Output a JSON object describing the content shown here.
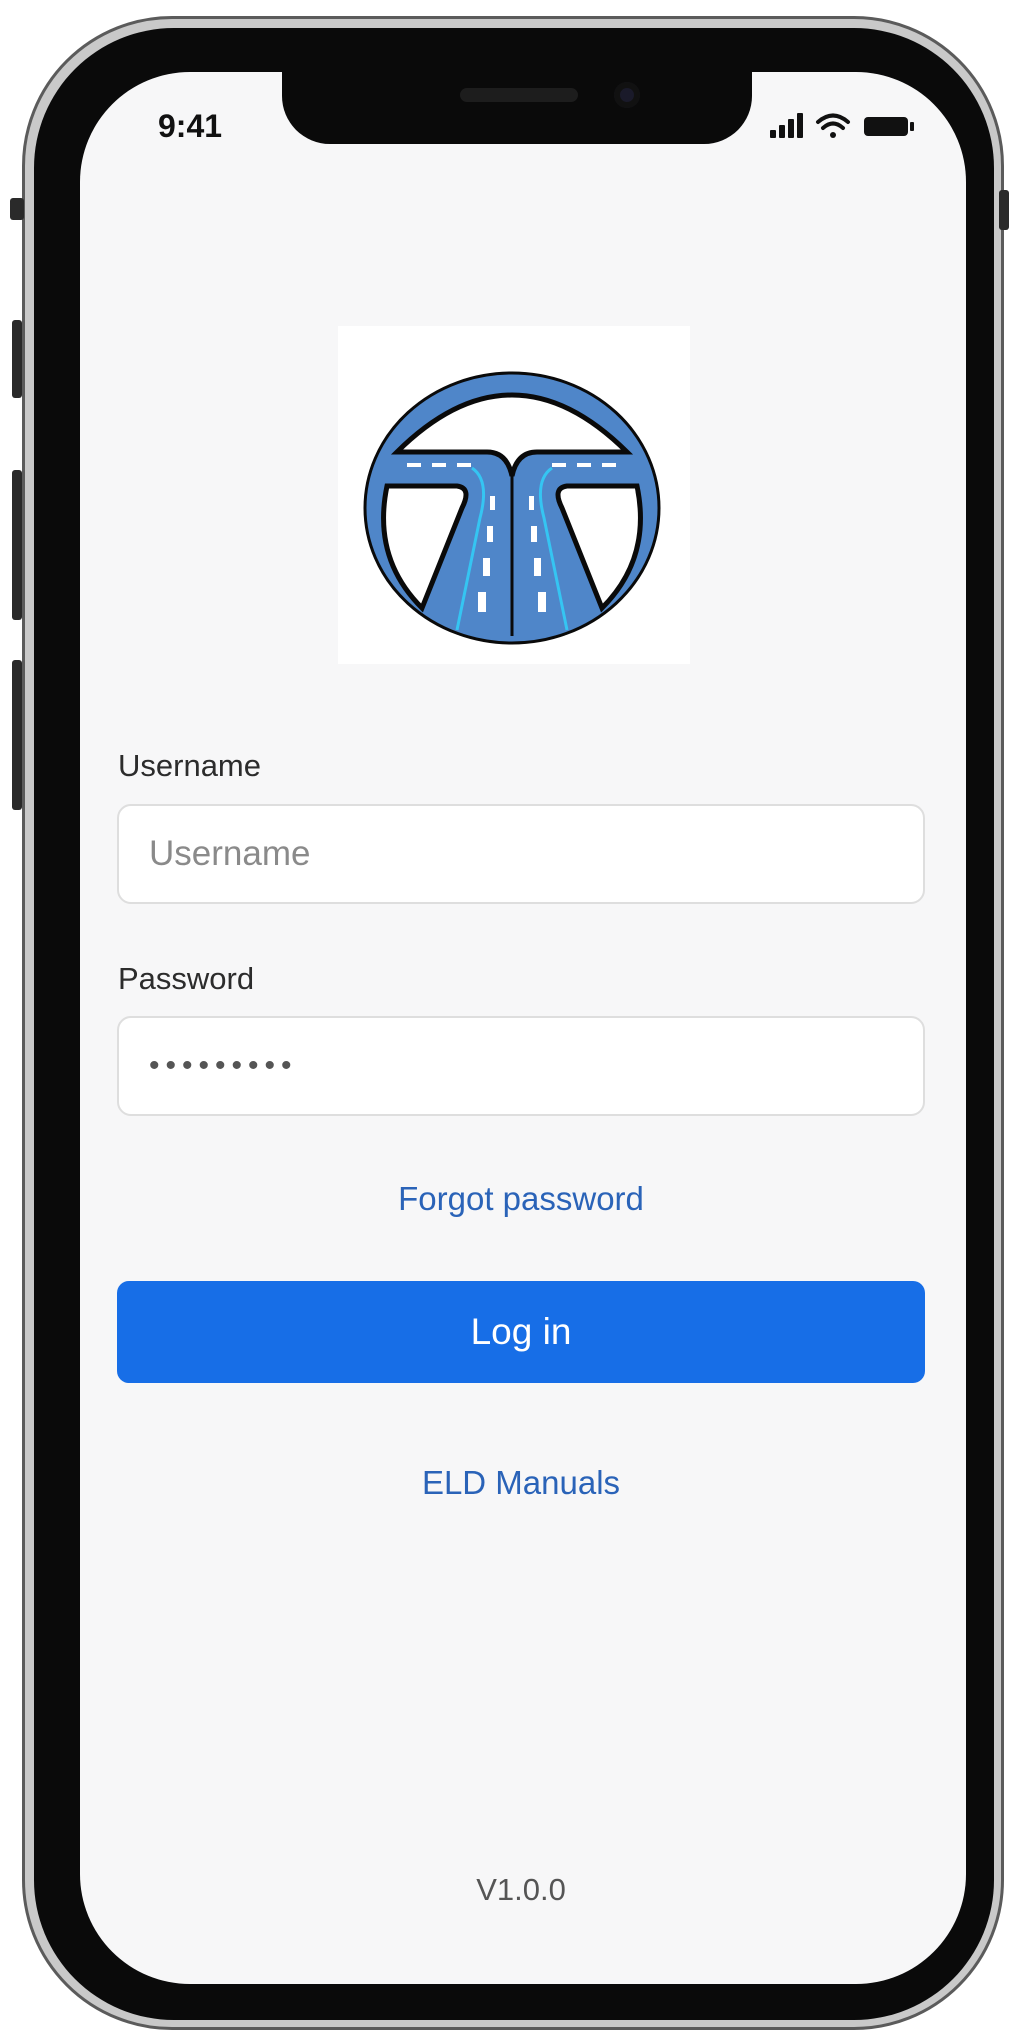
{
  "status_bar": {
    "time": "9:41",
    "icons": [
      "cellular-signal-icon",
      "wifi-icon",
      "battery-icon"
    ]
  },
  "logo": {
    "name": "road-logo",
    "colors": {
      "ring": "#4f86c9",
      "road": "#4f86c9",
      "outline": "#0a0a0a",
      "lane_marks": "#ffffff",
      "edge_glow": "#35c5f2"
    }
  },
  "login_form": {
    "username": {
      "label": "Username",
      "placeholder": "Username",
      "value": ""
    },
    "password": {
      "label": "Password",
      "value": "•••••••••"
    },
    "forgot_password_label": "Forgot password",
    "login_button_label": "Log in",
    "eld_manuals_label": "ELD Manuals"
  },
  "footer": {
    "version": "V1.0.0"
  },
  "colors": {
    "primary": "#176ee7",
    "link": "#2a63b8",
    "screen_background": "#f7f7f8"
  }
}
